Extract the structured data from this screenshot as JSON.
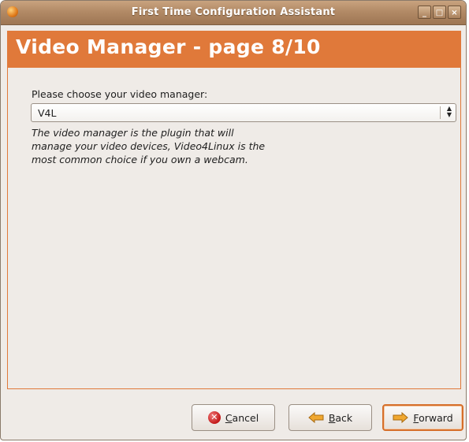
{
  "window": {
    "title": "First Time Configuration Assistant",
    "controls": {
      "minimize": "_",
      "maximize": "□",
      "close": "×"
    }
  },
  "header": {
    "title": "Video Manager - page 8/10"
  },
  "form": {
    "prompt": "Please choose your video manager:",
    "selected_value": "V4L",
    "description_lines": [
      "The video manager is the plugin that will",
      "manage your video devices, Video4Linux is the",
      "most common choice if you own a webcam."
    ]
  },
  "buttons": {
    "cancel": {
      "mnemonic": "C",
      "rest": "ancel"
    },
    "back": {
      "mnemonic": "B",
      "rest": "ack"
    },
    "forward": {
      "mnemonic": "F",
      "rest": "orward"
    }
  },
  "icons": {
    "app": "app-icon",
    "cancel": "cancel-icon",
    "back": "back-arrow-icon",
    "forward": "forward-arrow-icon",
    "combo": "combo-arrows-icon"
  },
  "colors": {
    "accent": "#e0793a",
    "titlebar": "#b28a66",
    "background": "#efebe7"
  }
}
